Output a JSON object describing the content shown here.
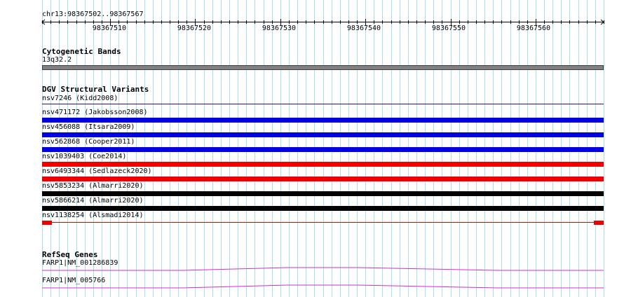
{
  "ruler": {
    "position": "chr13:98367502..98367567",
    "ticks": [
      "98367510",
      "98367520",
      "98367530",
      "98367540",
      "98367550",
      "98367560"
    ]
  },
  "cytoband": {
    "title": "Cytogenetic Bands",
    "band": "13q32.2"
  },
  "dgv": {
    "title": "DGV Structural Variants",
    "variants": [
      {
        "label": "nsv7246 (Kidd2008)",
        "color": "#3a0a7a"
      },
      {
        "label": "nsv471172 (Jakobsson2008)",
        "color": "#0000e0"
      },
      {
        "label": "nsv456088 (Itsara2009)",
        "color": "#0000e0"
      },
      {
        "label": "nsv562868 (Cooper2011)",
        "color": "#0000e0"
      },
      {
        "label": "nsv1039403 (Coe2014)",
        "color": "#ee0000"
      },
      {
        "label": "nsv6493344 (Sedlazeck2020)",
        "color": "#ee0000"
      },
      {
        "label": "nsv5853234 (Almarri2020)",
        "color": "#000000"
      },
      {
        "label": "nsv5866214 (Almarri2020)",
        "color": "#000000"
      },
      {
        "label": "nsv1138254 (Alsmadi2014)",
        "color": "#ee0000"
      }
    ]
  },
  "refseq": {
    "title": "RefSeq Genes",
    "genes": [
      {
        "label": "FARP1|NM_001286839",
        "color": "#cc33cc"
      },
      {
        "label": "FARP1|NM_005766",
        "color": "#cc33cc"
      }
    ]
  },
  "colors": {
    "gridline": "#aaddee",
    "cytoband": "#808080",
    "ruler": "#000000"
  }
}
